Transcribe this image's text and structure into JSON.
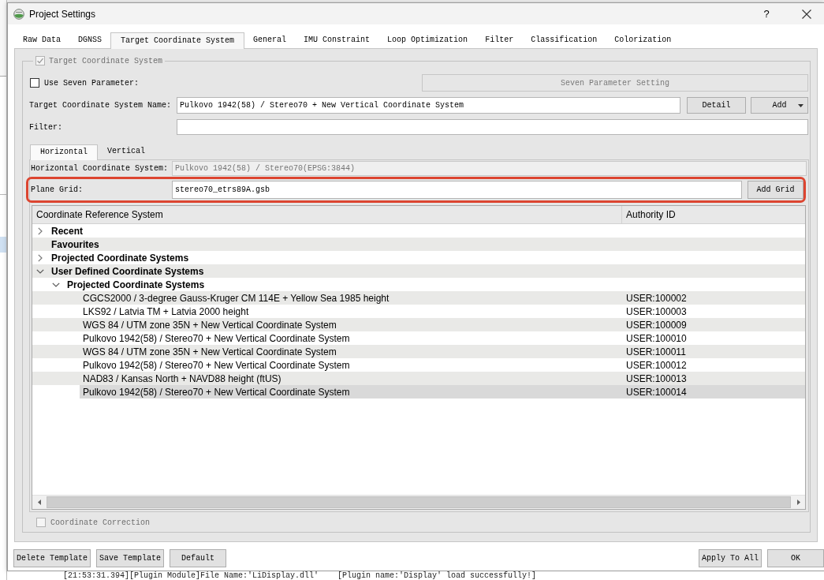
{
  "window": {
    "title": "Project Settings",
    "help": "?"
  },
  "tabs": [
    {
      "label": "Raw Data",
      "selected": false
    },
    {
      "label": "DGNSS",
      "selected": false
    },
    {
      "label": "Target Coordinate System",
      "selected": true
    },
    {
      "label": "General",
      "selected": false
    },
    {
      "label": "IMU Constraint",
      "selected": false
    },
    {
      "label": "Loop Optimization",
      "selected": false
    },
    {
      "label": "Filter",
      "selected": false
    },
    {
      "label": "Classification",
      "selected": false
    },
    {
      "label": "Colorization",
      "selected": false
    }
  ],
  "group": {
    "title": "Target Coordinate System",
    "checked": true,
    "disabled": true
  },
  "seven_parameter": {
    "label": "Use Seven Parameter:",
    "checked": false,
    "button": {
      "label": "Seven Parameter Setting",
      "disabled": true
    }
  },
  "target_name": {
    "label": "Target Coordinate System Name:",
    "value": "Pulkovo 1942(58) / Stereo70 + New Vertical Coordinate System",
    "buttons": [
      {
        "label": "Detail",
        "kind": "plain"
      },
      {
        "label": "Add",
        "kind": "dropdown"
      }
    ]
  },
  "filter": {
    "label": "Filter:"
  },
  "inner_tabs": [
    {
      "label": "Horizontal",
      "selected": true
    },
    {
      "label": "Vertical",
      "selected": false
    }
  ],
  "horizontal_system": {
    "label": "Horizontal Coordinate System:",
    "value": "Pulkovo 1942(58) / Stereo70(EPSG:3844)",
    "disabled": true
  },
  "plane_grid": {
    "label": "Plane Grid:",
    "value": "stereo70_etrs89A.gsb",
    "button": "Add Grid",
    "highlighted": true
  },
  "tree": {
    "columns": [
      "Coordinate Reference System",
      "Authority ID"
    ],
    "items": [
      {
        "name": "Recent",
        "kind": "folder",
        "expanded": false,
        "selected": false
      },
      {
        "name": "Favourites",
        "kind": "category",
        "selected": false
      },
      {
        "name": "Projected Coordinate Systems",
        "kind": "folder",
        "expanded": false,
        "selected": false
      },
      {
        "name": "User Defined Coordinate Systems",
        "kind": "folder",
        "expanded": true,
        "selected": false,
        "children": [
          {
            "name": "Projected Coordinate Systems",
            "kind": "folder",
            "expanded": true,
            "selected": false,
            "children": [
              {
                "name": "CGCS2000 / 3-degree Gauss-Kruger CM 114E + Yellow Sea 1985 height",
                "kind": "crs",
                "authority_id": "USER:100002",
                "selected": false
              },
              {
                "name": "LKS92 / Latvia TM + Latvia 2000 height",
                "kind": "crs",
                "authority_id": "USER:100003",
                "selected": false
              },
              {
                "name": "WGS 84 / UTM zone 35N + New Vertical Coordinate System",
                "kind": "crs",
                "authority_id": "USER:100009",
                "selected": false
              },
              {
                "name": "Pulkovo 1942(58) / Stereo70 + New Vertical Coordinate System",
                "kind": "crs",
                "authority_id": "USER:100010",
                "selected": false
              },
              {
                "name": "WGS 84 / UTM zone 35N + New Vertical Coordinate System",
                "kind": "crs",
                "authority_id": "USER:100011",
                "selected": false
              },
              {
                "name": "Pulkovo 1942(58) / Stereo70 + New Vertical Coordinate System",
                "kind": "crs",
                "authority_id": "USER:100012",
                "selected": false
              },
              {
                "name": "NAD83 / Kansas North + NAVD88 height (ftUS)",
                "kind": "crs",
                "authority_id": "USER:100013",
                "selected": false
              },
              {
                "name": "Pulkovo 1942(58) / Stereo70 + New Vertical Coordinate System",
                "kind": "crs",
                "authority_id": "USER:100014",
                "selected": true
              }
            ]
          }
        ]
      }
    ]
  },
  "coordinate_correction": {
    "label": "Coordinate Correction",
    "checked": false,
    "disabled": true
  },
  "footer": {
    "left_buttons": [
      "Delete Template",
      "Save Template",
      "Default"
    ],
    "right_buttons": [
      "Apply To All",
      "OK"
    ]
  },
  "background": {
    "log_line": "[21:53:31.394][Plugin Module]File Name:'LiDisplay.dll'    [Plugin name:'Display' load successfully!]"
  }
}
